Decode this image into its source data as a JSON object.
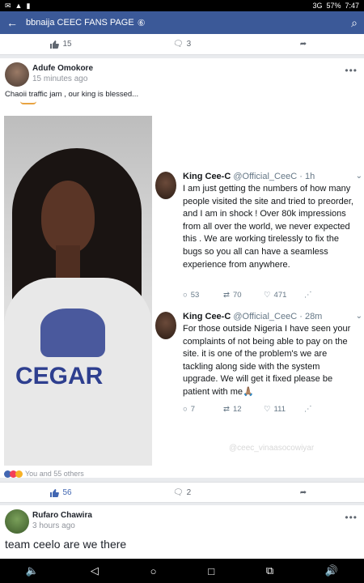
{
  "status_bar": {
    "left_icons": [
      "✉",
      "▲",
      "▮"
    ],
    "network": "3G",
    "battery": "57%",
    "time": "7:47"
  },
  "app_bar": {
    "title": "bbnaija CEEC FANS PAGE",
    "verified_mark": "⑥"
  },
  "top_actions": {
    "likes": "15",
    "comments": "3"
  },
  "post": {
    "author": "Adufe Omokore",
    "time": "15 minutes ago",
    "text": "Chaoii traffic jam , our king is blessed...",
    "shirt_text": "CEGAR",
    "watermark": "@ceec_vinaasocowiyar"
  },
  "tweets": [
    {
      "name": "King Cee-C",
      "handle": "@Official_CeeC · 1h",
      "text": "I am just getting the numbers of how many people visited the site and tried to preorder, and I am in shock ! Over 80k impressions from all over the world, we never expected this . We are working tirelessly to fix the bugs so you all can have a seamless experience from anywhere.",
      "replies": "53",
      "retweets": "70",
      "likes": "471"
    },
    {
      "name": "King Cee-C",
      "handle": "@Official_CeeC · 28m",
      "text": "For those outside Nigeria I have seen your complaints of not being able to pay on the site. it is one of the problem's we are tackling along side with the system upgrade. We will get it fixed please be patient with me🙏🏽",
      "replies": "7",
      "retweets": "12",
      "likes": "111"
    }
  ],
  "reactions_text": "You and 55 others",
  "post_actions": {
    "likes": "56",
    "comments": "2"
  },
  "comment": {
    "author": "Rufaro Chawira",
    "time": "3 hours ago",
    "text": "team ceelo are we there"
  },
  "colors": {
    "facebook_blue": "#3b5998",
    "twitter_gray": "#657786"
  }
}
